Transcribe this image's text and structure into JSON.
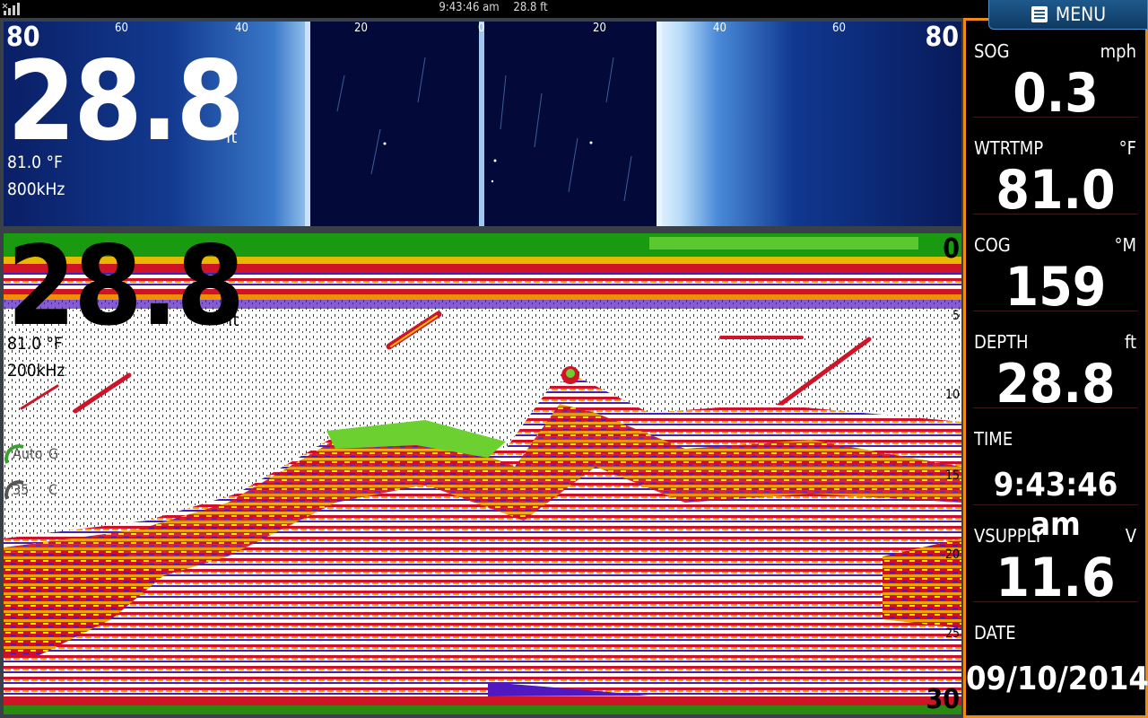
{
  "status_bar": {
    "time": "9:43:46 am",
    "depth": "28.8 ft"
  },
  "menu": {
    "label": "MENU"
  },
  "sidebar": {
    "boxes": [
      {
        "label": "SOG",
        "unit": "mph",
        "value": "0.3"
      },
      {
        "label": "WTRTMP",
        "unit": "°F",
        "value": "81.0"
      },
      {
        "label": "COG",
        "unit": "°M",
        "value": "159"
      },
      {
        "label": "DEPTH",
        "unit": "ft",
        "value": "28.8"
      },
      {
        "label": "TIME",
        "unit": "",
        "value": "9:43:46 am"
      },
      {
        "label": "VSUPPLY",
        "unit": "V",
        "value": "11.6"
      },
      {
        "label": "DATE",
        "unit": "",
        "value": "09/10/2014"
      }
    ]
  },
  "sidescan": {
    "range_left": "80",
    "range_right": "80",
    "ruler_ticks": [
      "60",
      "40",
      "20",
      "0",
      "20",
      "40",
      "60"
    ],
    "depth": "28.8",
    "depth_unit": "ft",
    "temperature": "81.0 °F",
    "frequency": "800kHz"
  },
  "sonar": {
    "depth": "28.8",
    "depth_unit": "ft",
    "temperature": "81.0 °F",
    "frequency": "200kHz",
    "scale_top": "0",
    "scale_ticks": [
      "5",
      "10",
      "15",
      "20",
      "25"
    ],
    "scale_bottom": "30",
    "gain": {
      "label": "Auto",
      "suffix": "G"
    },
    "contrast": {
      "label": "35",
      "suffix": "C"
    }
  },
  "colors": {
    "sidebar_border": "#f08a10",
    "menu_button": "#1e5a8c",
    "sidescan_background": "#061a55",
    "sonar_surface_green": "#1a9a10"
  },
  "icons": {
    "signal": "signal-bars-icon",
    "menu": "menu-list-icon"
  }
}
